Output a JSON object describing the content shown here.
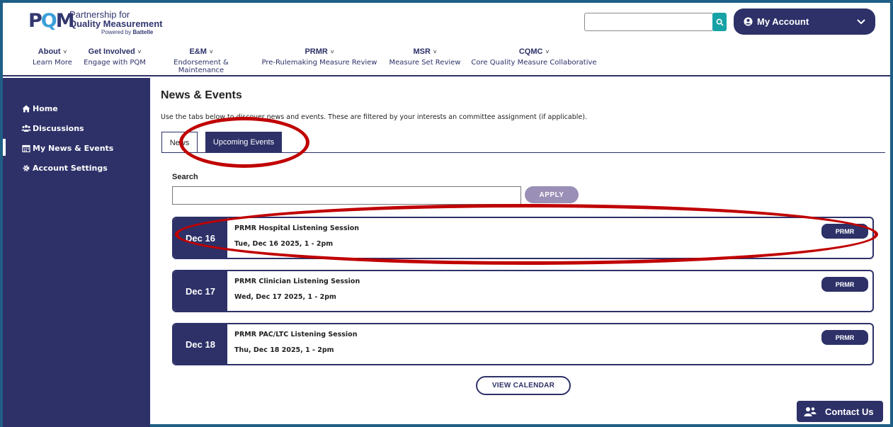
{
  "logo": {
    "mark": "PQM",
    "line1": "Partnership for",
    "line2": "Quality Measurement",
    "line3_prefix": "Powered by ",
    "line3_brand": "Battelle"
  },
  "search_top": {
    "value": "",
    "placeholder": ""
  },
  "account": {
    "label": "My Account"
  },
  "nav": [
    {
      "top": "About",
      "bottom": "Learn More"
    },
    {
      "top": "Get Involved",
      "bottom": "Engage with PQM"
    },
    {
      "top": "E&M",
      "bottom": "Endorsement & Maintenance"
    },
    {
      "top": "PRMR",
      "bottom": "Pre-Rulemaking Measure Review"
    },
    {
      "top": "MSR",
      "bottom": "Measure Set Review"
    },
    {
      "top": "CQMC",
      "bottom": "Core Quality Measure Collaborative"
    }
  ],
  "sidebar": {
    "items": [
      {
        "label": "Home",
        "icon": "home-icon"
      },
      {
        "label": "Discussions",
        "icon": "users-icon"
      },
      {
        "label": "My News & Events",
        "icon": "calendar-icon"
      },
      {
        "label": "Account Settings",
        "icon": "gear-icon"
      }
    ]
  },
  "main": {
    "title": "News & Events",
    "description": "Use the tabs below to discover news and events. These are filtered by your interests an committee assignment (if applicable).",
    "tabs": [
      "News",
      "Upcoming Events"
    ],
    "search_label": "Search",
    "search_value": "",
    "apply_label": "APPLY",
    "events": [
      {
        "date": "Dec 16",
        "name": "PRMR Hospital Listening Session",
        "time": "Tue, Dec 16 2025, 1 - 2pm",
        "badge": "PRMR"
      },
      {
        "date": "Dec 17",
        "name": "PRMR Clinician Listening Session",
        "time": "Wed, Dec 17 2025, 1 - 2pm",
        "badge": "PRMR"
      },
      {
        "date": "Dec 18",
        "name": "PRMR PAC/LTC Listening Session",
        "time": "Thu, Dec 18 2025, 1 - 2pm",
        "badge": "PRMR"
      }
    ],
    "view_calendar_label": "VIEW CALENDAR"
  },
  "contact": {
    "label": "Contact Us"
  },
  "colors": {
    "navy": "#2d3168",
    "teal": "#17a2a6",
    "annotation_red": "#c00000",
    "apply_purple": "#9a8fb6"
  }
}
